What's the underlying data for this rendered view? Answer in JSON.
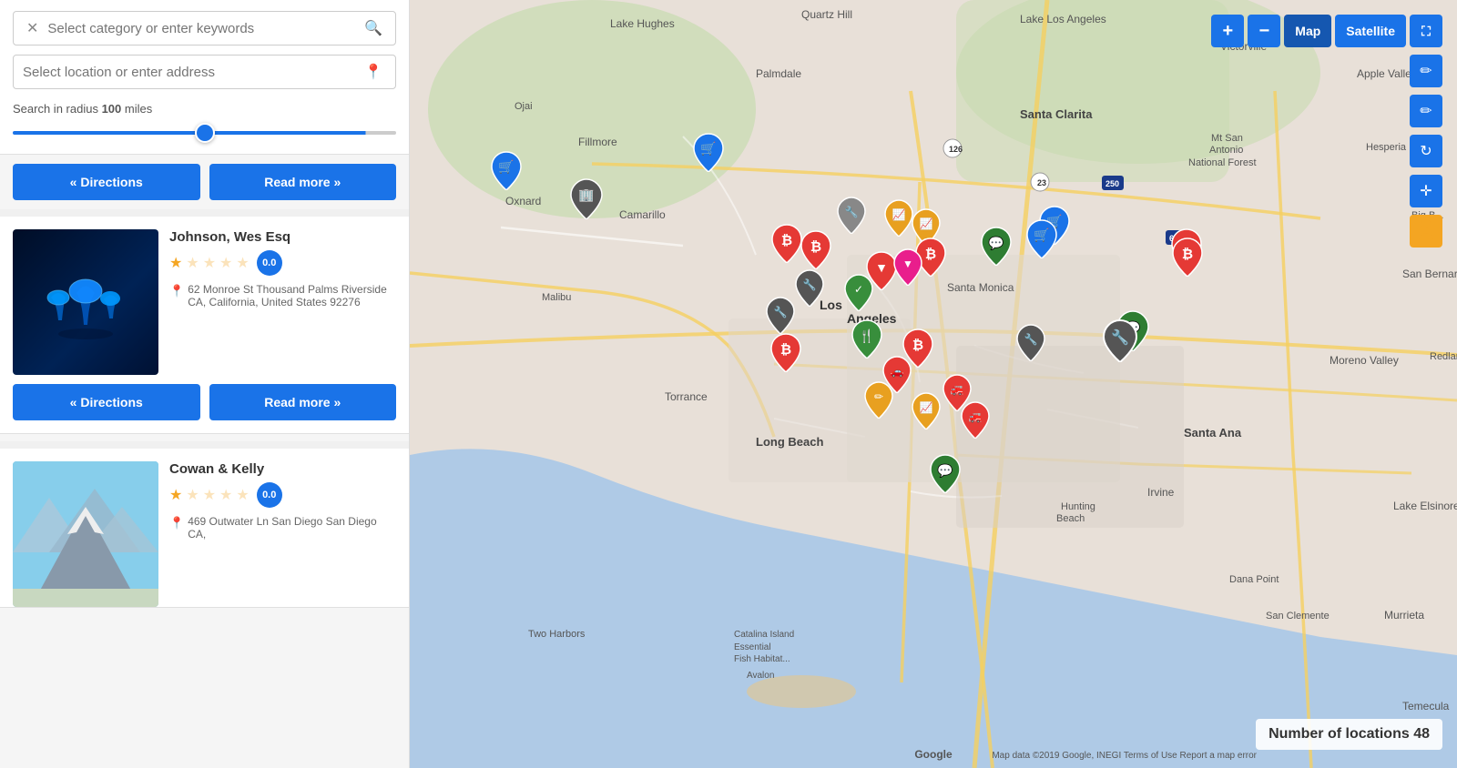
{
  "search": {
    "keyword_placeholder": "Select category or enter keywords",
    "location_placeholder": "Select location or enter address",
    "radius_label": "Search in radius",
    "radius_value": "100",
    "radius_unit": "miles"
  },
  "buttons": {
    "directions_label": "« Directions",
    "read_more_label": "Read more »",
    "read_more_label2": "Read more »",
    "map_label": "Map",
    "satellite_label": "Satellite",
    "zoom_in": "+",
    "zoom_out": "−"
  },
  "listings": [
    {
      "id": "listing-1",
      "name": "Johnson, Wes Esq",
      "rating": "0.0",
      "stars": 0,
      "address": "62 Monroe St Thousand Palms Riverside CA, California, United States 92276",
      "image_type": "mushroom"
    },
    {
      "id": "listing-2",
      "name": "Cowan & Kelly",
      "rating": "0.0",
      "stars": 0,
      "address": "469 Outwater Ln San Diego San Diego CA,",
      "image_type": "mountain"
    }
  ],
  "map": {
    "location_count_label": "Number of locations",
    "location_count": "48",
    "google_label": "Google",
    "terms_label": "Map data ©2019 Google, INEGI   Terms of Use   Report a map error"
  }
}
